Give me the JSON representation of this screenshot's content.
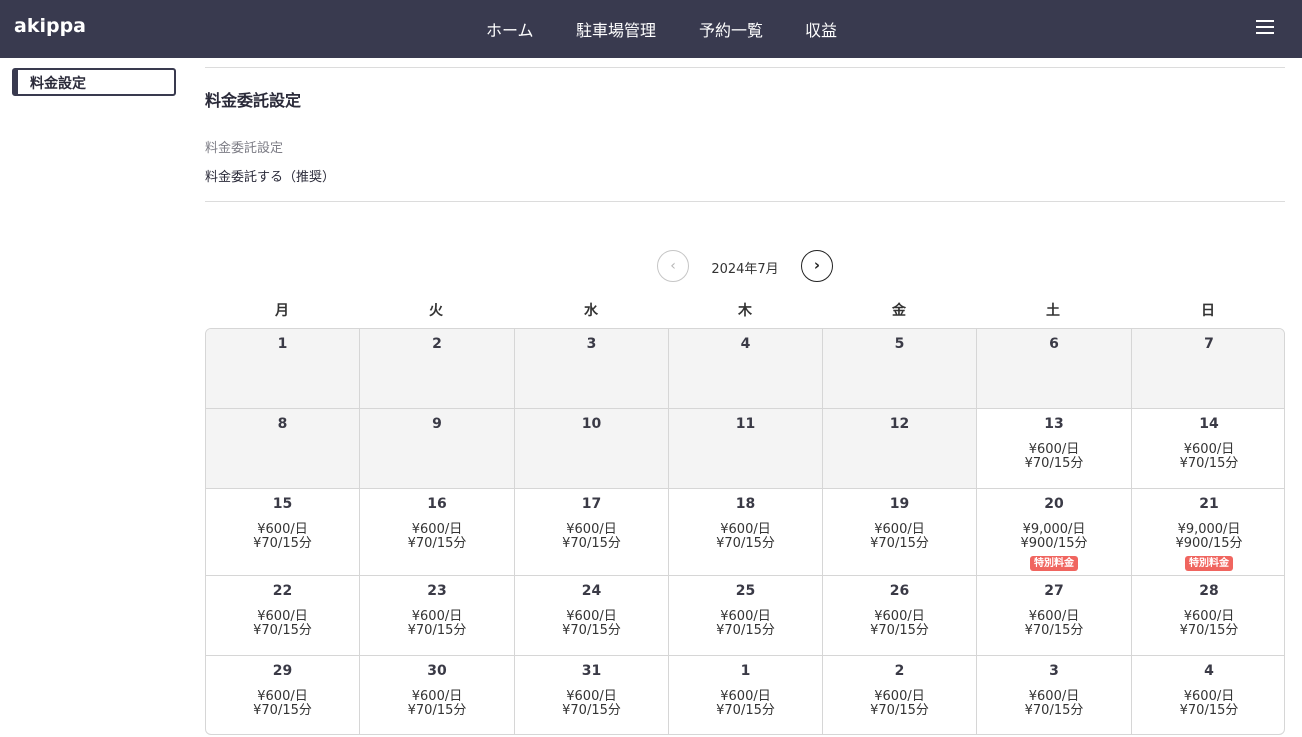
{
  "header": {
    "logo": "akippa",
    "nav": [
      "ホーム",
      "駐車場管理",
      "予約一覧",
      "収益"
    ],
    "menu_icon": "hamburger-icon",
    "background": "#393a4f"
  },
  "sidebar": {
    "items": [
      {
        "label": "料金設定",
        "active": true
      }
    ]
  },
  "main": {
    "title": "料金委託設定",
    "field_label": "料金委託設定",
    "field_value": "料金委託する（推奨）"
  },
  "calendar": {
    "month_label": "2024年7月",
    "prev_icon": "chevron-left-icon",
    "next_icon": "chevron-right-icon",
    "weekdays": [
      "月",
      "火",
      "水",
      "木",
      "金",
      "土",
      "日"
    ],
    "badge_color": "#f0655f",
    "rows": [
      [
        {
          "day": "1"
        },
        {
          "day": "2"
        },
        {
          "day": "3"
        },
        {
          "day": "4"
        },
        {
          "day": "5"
        },
        {
          "day": "6"
        },
        {
          "day": "7"
        }
      ],
      [
        {
          "day": "8"
        },
        {
          "day": "9"
        },
        {
          "day": "10"
        },
        {
          "day": "11"
        },
        {
          "day": "12"
        },
        {
          "day": "13",
          "line1": "¥600/日",
          "line2": "¥70/15分"
        },
        {
          "day": "14",
          "line1": "¥600/日",
          "line2": "¥70/15分"
        }
      ],
      [
        {
          "day": "15",
          "line1": "¥600/日",
          "line2": "¥70/15分"
        },
        {
          "day": "16",
          "line1": "¥600/日",
          "line2": "¥70/15分"
        },
        {
          "day": "17",
          "line1": "¥600/日",
          "line2": "¥70/15分"
        },
        {
          "day": "18",
          "line1": "¥600/日",
          "line2": "¥70/15分"
        },
        {
          "day": "19",
          "line1": "¥600/日",
          "line2": "¥70/15分"
        },
        {
          "day": "20",
          "line1": "¥9,000/日",
          "line2": "¥900/15分",
          "badge": "特別料金"
        },
        {
          "day": "21",
          "line1": "¥9,000/日",
          "line2": "¥900/15分",
          "badge": "特別料金"
        }
      ],
      [
        {
          "day": "22",
          "line1": "¥600/日",
          "line2": "¥70/15分"
        },
        {
          "day": "23",
          "line1": "¥600/日",
          "line2": "¥70/15分"
        },
        {
          "day": "24",
          "line1": "¥600/日",
          "line2": "¥70/15分"
        },
        {
          "day": "25",
          "line1": "¥600/日",
          "line2": "¥70/15分"
        },
        {
          "day": "26",
          "line1": "¥600/日",
          "line2": "¥70/15分"
        },
        {
          "day": "27",
          "line1": "¥600/日",
          "line2": "¥70/15分"
        },
        {
          "day": "28",
          "line1": "¥600/日",
          "line2": "¥70/15分"
        }
      ],
      [
        {
          "day": "29",
          "line1": "¥600/日",
          "line2": "¥70/15分"
        },
        {
          "day": "30",
          "line1": "¥600/日",
          "line2": "¥70/15分"
        },
        {
          "day": "31",
          "line1": "¥600/日",
          "line2": "¥70/15分"
        },
        {
          "day": "1",
          "line1": "¥600/日",
          "line2": "¥70/15分"
        },
        {
          "day": "2",
          "line1": "¥600/日",
          "line2": "¥70/15分"
        },
        {
          "day": "3",
          "line1": "¥600/日",
          "line2": "¥70/15分"
        },
        {
          "day": "4",
          "line1": "¥600/日",
          "line2": "¥70/15分"
        }
      ]
    ]
  }
}
